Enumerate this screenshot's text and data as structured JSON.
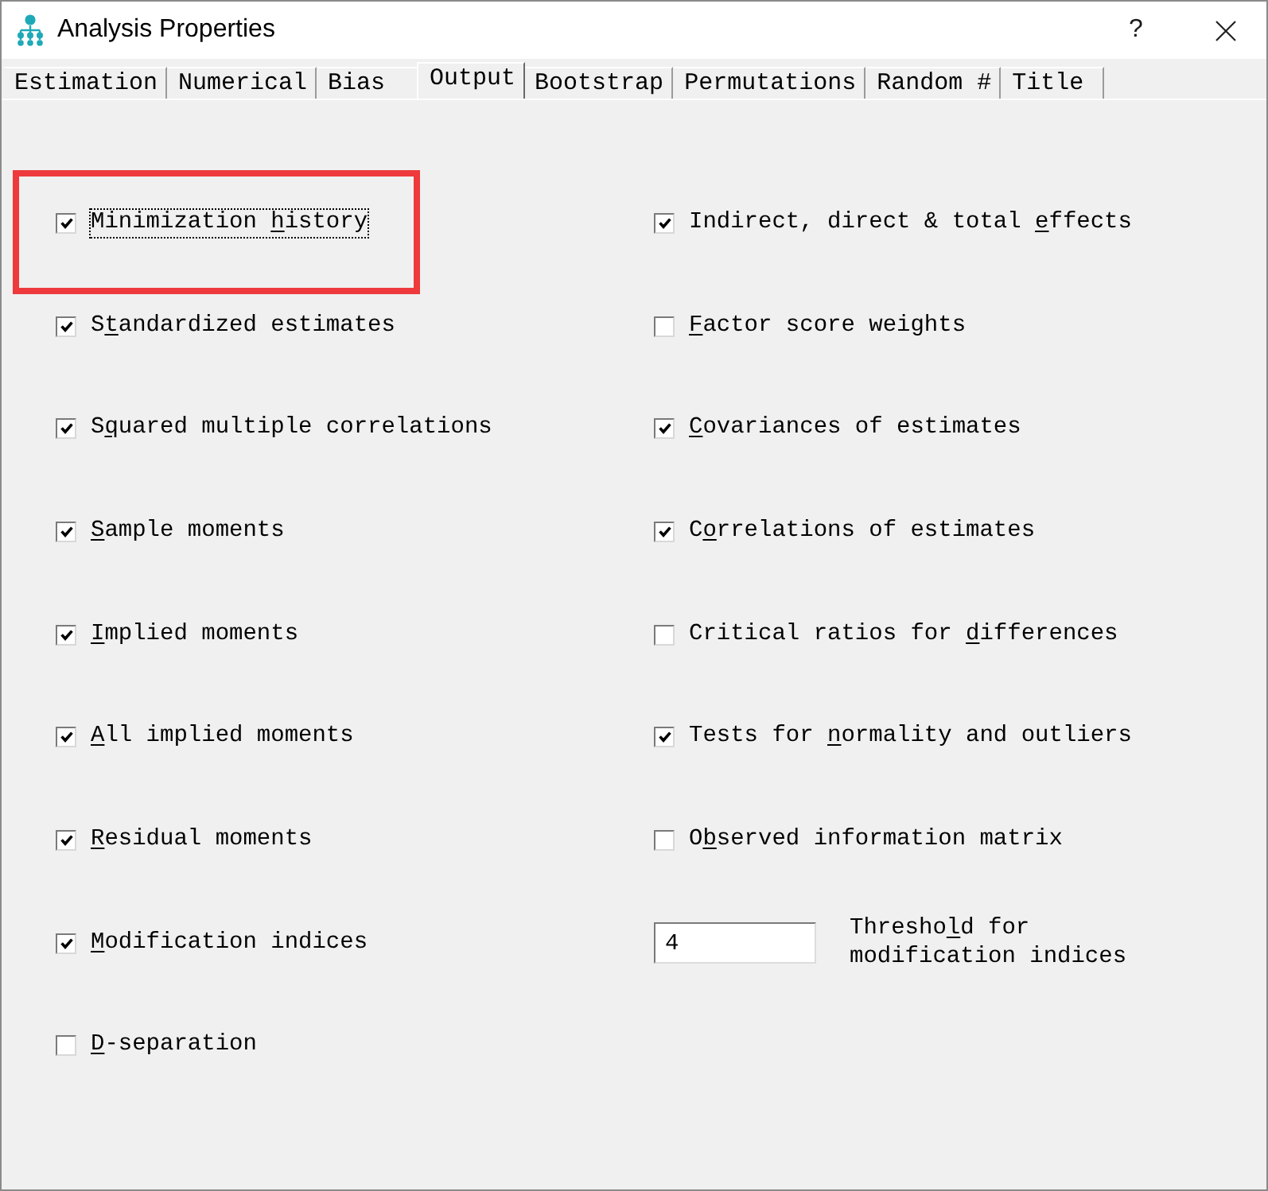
{
  "window": {
    "title": "Analysis Properties",
    "help_button": "?"
  },
  "tabs": [
    {
      "label": "Estimation",
      "selected": false
    },
    {
      "label": "Numerical",
      "selected": false
    },
    {
      "label": "Bias",
      "selected": false
    },
    {
      "label": "Output",
      "selected": true
    },
    {
      "label": "Bootstrap",
      "selected": false
    },
    {
      "label": "Permutations",
      "selected": false
    },
    {
      "label": "Random #",
      "selected": false
    },
    {
      "label": "Title",
      "selected": false
    }
  ],
  "options": {
    "left_column": [
      {
        "kind": "checkbox",
        "label": {
          "before": "Minimization ",
          "key": "h",
          "after": "istory"
        },
        "checked": true,
        "focused": true,
        "highlighted": true
      },
      {
        "kind": "checkbox",
        "label": {
          "before": "S",
          "key": "t",
          "after": "andardized estimates"
        },
        "checked": true,
        "focused": false,
        "highlighted": false
      },
      {
        "kind": "checkbox",
        "label": {
          "before": "S",
          "key": "q",
          "after": "uared multiple correlations"
        },
        "checked": true,
        "focused": false,
        "highlighted": false
      },
      {
        "kind": "checkbox",
        "label": {
          "key": "S",
          "after": "ample moments"
        },
        "checked": true,
        "focused": false,
        "highlighted": false
      },
      {
        "kind": "checkbox",
        "label": {
          "key": "I",
          "after": "mplied moments"
        },
        "checked": true,
        "focused": false,
        "highlighted": false
      },
      {
        "kind": "checkbox",
        "label": {
          "key": "A",
          "after": "ll implied moments"
        },
        "checked": true,
        "focused": false,
        "highlighted": false
      },
      {
        "kind": "checkbox",
        "label": {
          "key": "R",
          "after": "esidual moments"
        },
        "checked": true,
        "focused": false,
        "highlighted": false
      },
      {
        "kind": "checkbox",
        "label": {
          "key": "M",
          "after": "odification indices"
        },
        "checked": true,
        "focused": false,
        "highlighted": false
      },
      {
        "kind": "checkbox",
        "label": {
          "key": "D",
          "after": "-separation"
        },
        "checked": false,
        "focused": false,
        "highlighted": false
      }
    ],
    "right_column": [
      {
        "kind": "checkbox",
        "label": {
          "before": "Indirect, direct & total ",
          "key": "e",
          "after": "ffects"
        },
        "checked": true,
        "focused": false,
        "highlighted": false
      },
      {
        "kind": "checkbox",
        "label": {
          "key": "F",
          "after": "actor score weights"
        },
        "checked": false,
        "focused": false,
        "highlighted": false
      },
      {
        "kind": "checkbox",
        "label": {
          "key": "C",
          "after": "ovariances of estimates"
        },
        "checked": true,
        "focused": false,
        "highlighted": false
      },
      {
        "kind": "checkbox",
        "label": {
          "before": "C",
          "key": "o",
          "after": "rrelations of estimates"
        },
        "checked": true,
        "focused": false,
        "highlighted": false
      },
      {
        "kind": "checkbox",
        "label": {
          "before": "Critical ratios for ",
          "key": "d",
          "after": "ifferences"
        },
        "checked": false,
        "focused": false,
        "highlighted": false
      },
      {
        "kind": "checkbox",
        "label": {
          "before": "Tests for ",
          "key": "n",
          "after": "ormality and outliers"
        },
        "checked": true,
        "focused": false,
        "highlighted": false
      },
      {
        "kind": "checkbox",
        "label": {
          "before": "O",
          "key": "b",
          "after": "served information matrix"
        },
        "checked": false,
        "focused": false,
        "highlighted": false
      },
      {
        "kind": "number_field",
        "value": "4",
        "label": {
          "before": "Thresho",
          "key": "l",
          "after": "d for modification indices"
        }
      }
    ]
  }
}
